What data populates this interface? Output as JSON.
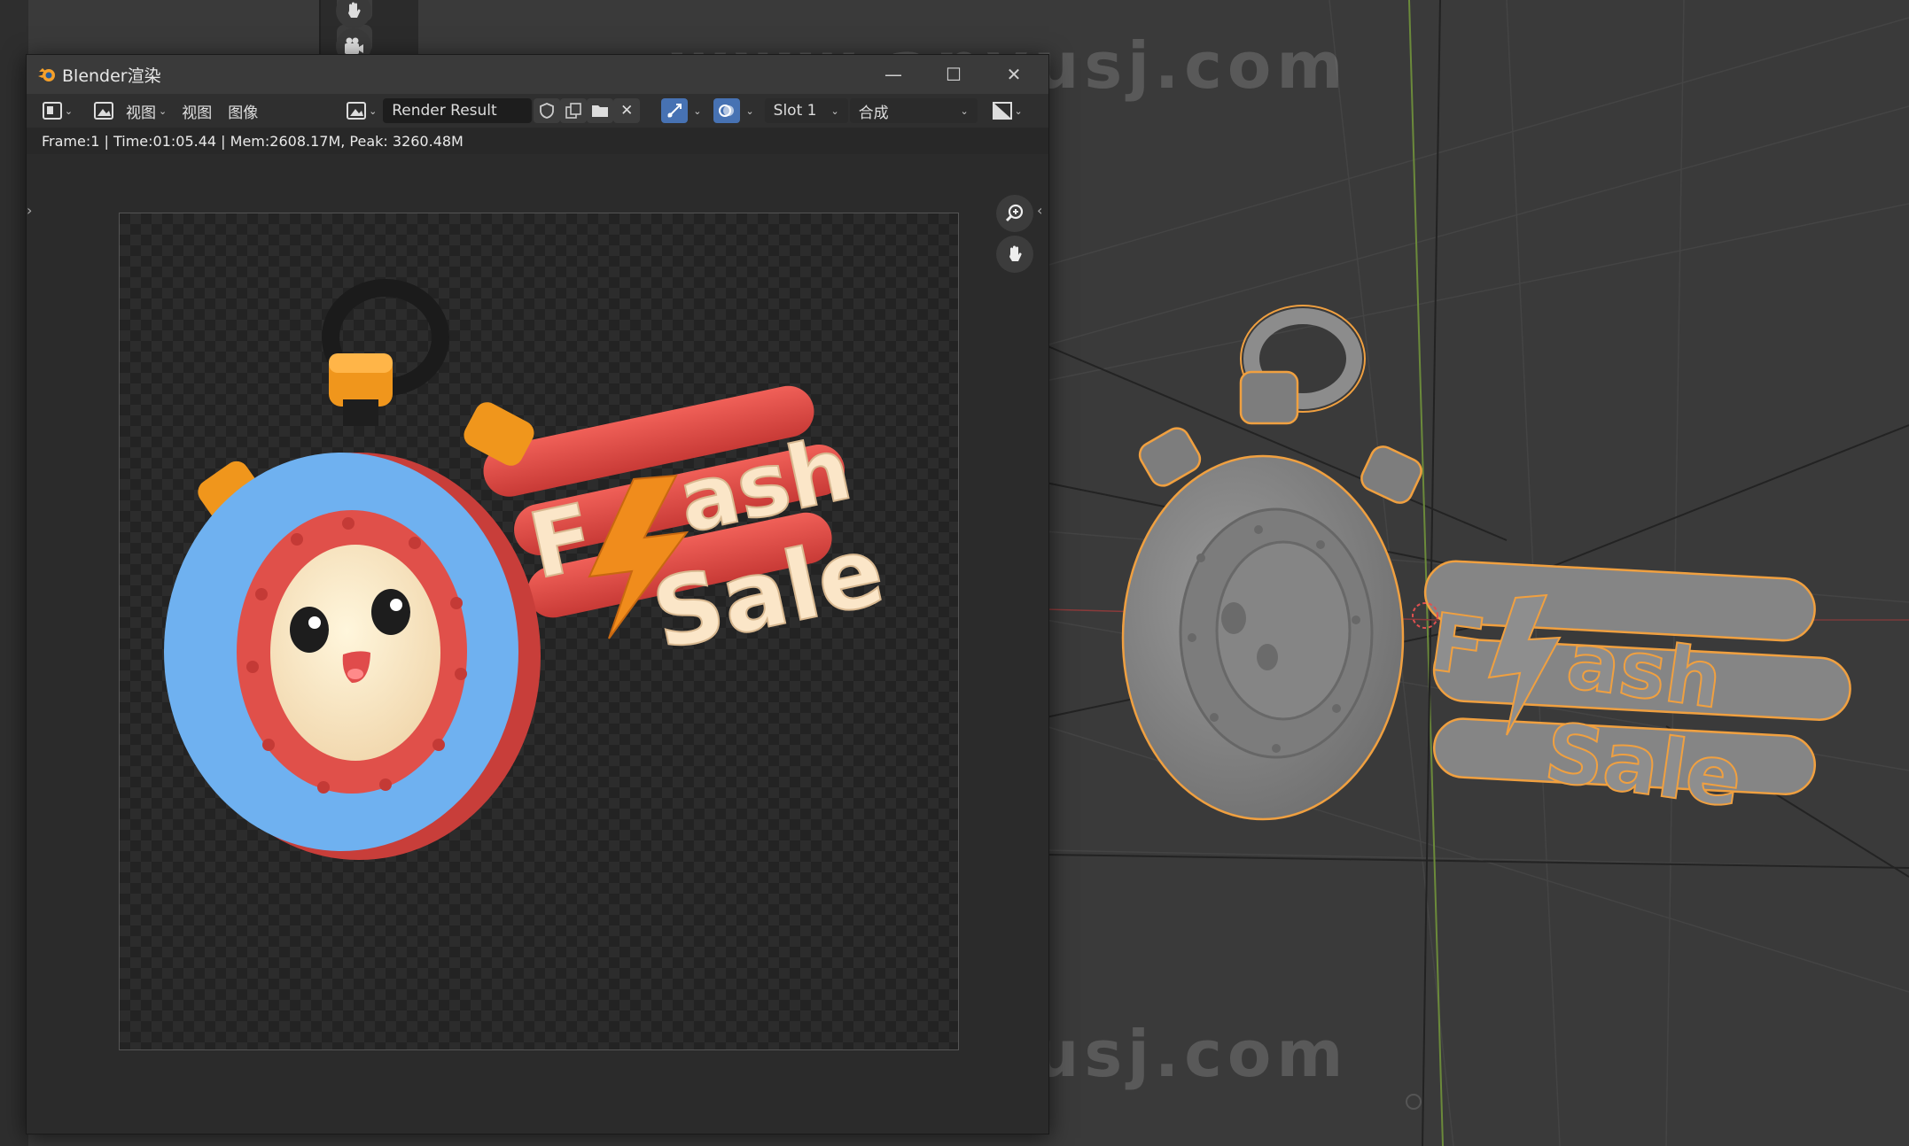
{
  "window": {
    "app_title": "Blender渲染",
    "minimize_glyph": "—",
    "maximize_glyph": "☐",
    "close_glyph": "✕"
  },
  "toolbar": {
    "menu_view": "视图",
    "menu_view2": "视图",
    "menu_image": "图像",
    "image_name": "Render Result",
    "slot": "Slot 1",
    "layer": "合成",
    "close_glyph": "✕",
    "dropdown_glyph": "⌄"
  },
  "status": {
    "text": "Frame:1 | Time:01:05.44 | Mem:2608.17M, Peak: 3260.48M"
  },
  "render": {
    "flash_line1": "F",
    "flash_line1b": "ash",
    "flash_line2": "Sale"
  },
  "viewport_model": {
    "flash_line1": "F",
    "flash_line1b": "ash",
    "flash_line2": "Sale"
  },
  "watermark": {
    "text": "www.anyusj.com"
  },
  "colors": {
    "viewport_bg": "#3a3a3a",
    "window_bg": "#282828",
    "accent_blue": "#4772b3",
    "selection_orange": "#f0a040",
    "clock_blue": "#6fb1f0",
    "clock_red": "#e0504a",
    "knob_orange": "#f0961c",
    "text_cream": "#fbe6c8",
    "lightning_orange": "#f08c1c",
    "model_gray": "#8a8a8a"
  },
  "icons": [
    "blender-logo-icon",
    "editor-type-icon",
    "image-icon",
    "shield-icon",
    "duplicate-icon",
    "folder-icon",
    "close-icon",
    "gizmo-icon",
    "overlay-icon",
    "display-channels-icon",
    "zoom-icon",
    "hand-icon",
    "camera-icon",
    "resize-icon"
  ]
}
